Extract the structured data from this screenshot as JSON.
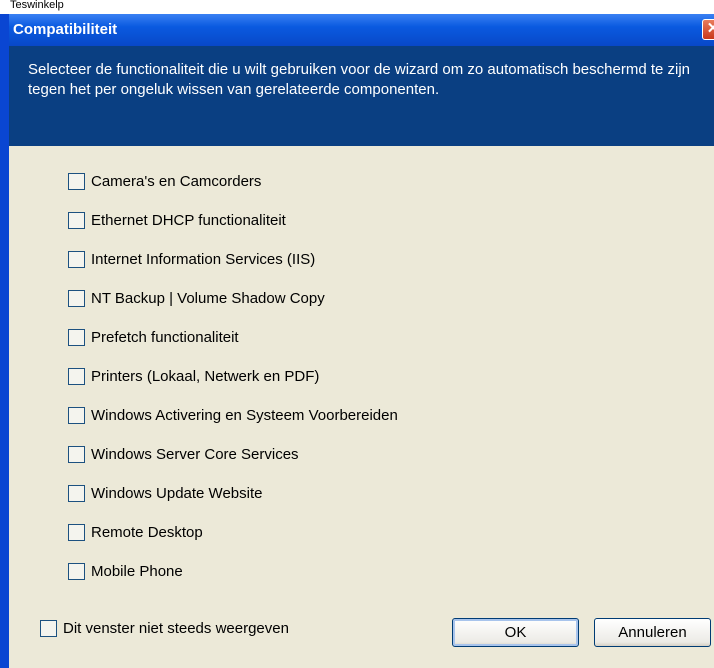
{
  "window": {
    "title": "Compatibiliteit",
    "close_glyph": "✕",
    "background_partial_text": "Teswinkelp"
  },
  "header": {
    "description": "Selecteer de functionaliteit die u wilt gebruiken voor de wizard om zo automatisch beschermd te zijn tegen het per ongeluk wissen van gerelateerde componenten."
  },
  "options": [
    {
      "label": "Camera's en Camcorders",
      "checked": false
    },
    {
      "label": "Ethernet DHCP functionaliteit",
      "checked": false
    },
    {
      "label": "Internet Information Services (IIS)",
      "checked": false
    },
    {
      "label": "NT Backup | Volume Shadow Copy",
      "checked": false
    },
    {
      "label": "Prefetch functionaliteit",
      "checked": false
    },
    {
      "label": "Printers (Lokaal, Netwerk en PDF)",
      "checked": false
    },
    {
      "label": "Windows Activering en Systeem Voorbereiden",
      "checked": false
    },
    {
      "label": "Windows Server Core Services",
      "checked": false
    },
    {
      "label": "Windows Update Website",
      "checked": false
    },
    {
      "label": "Remote Desktop",
      "checked": false
    },
    {
      "label": "Mobile Phone",
      "checked": false
    }
  ],
  "footer": {
    "dont_show_label": "Dit venster niet steeds weergeven",
    "dont_show_checked": false,
    "ok_label": "OK",
    "cancel_label": "Annuleren"
  },
  "colors": {
    "title_bar": "#0a5ae0",
    "header_panel": "#0a3f82",
    "dialog_body": "#ece9d8",
    "close_button": "#c9381a"
  }
}
